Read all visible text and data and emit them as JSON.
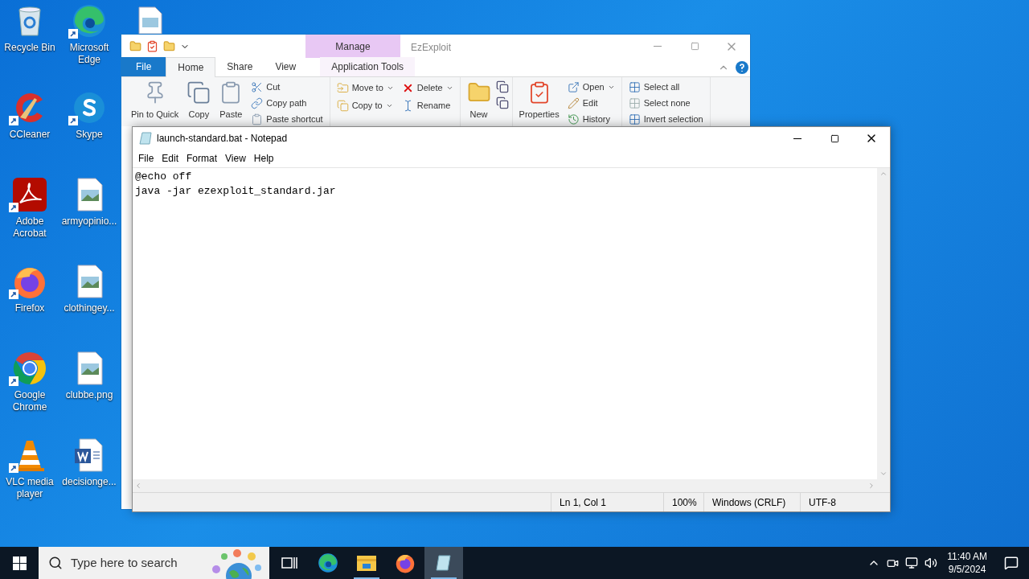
{
  "desktop_icons": [
    {
      "label": "Recycle Bin",
      "kind": "recycle",
      "shortcut": false
    },
    {
      "label": "Microsoft Edge",
      "kind": "edge",
      "shortcut": true
    },
    {
      "label": "CCleaner",
      "kind": "ccleaner",
      "shortcut": true
    },
    {
      "label": "Skype",
      "kind": "skype",
      "shortcut": true
    },
    {
      "label": "Adobe Acrobat",
      "kind": "acrobat",
      "shortcut": true
    },
    {
      "label": "armyopinio...",
      "kind": "image",
      "shortcut": false
    },
    {
      "label": "Firefox",
      "kind": "firefox",
      "shortcut": true
    },
    {
      "label": "clothingey...",
      "kind": "image",
      "shortcut": false
    },
    {
      "label": "Google Chrome",
      "kind": "chrome",
      "shortcut": true
    },
    {
      "label": "clubbe.png",
      "kind": "image",
      "shortcut": false
    },
    {
      "label": "VLC media player",
      "kind": "vlc",
      "shortcut": true
    },
    {
      "label": "decisionge...",
      "kind": "word",
      "shortcut": false
    }
  ],
  "explorer": {
    "context_tab": "Manage",
    "title": "EzExploit",
    "tabs": [
      {
        "label": "File",
        "kind": "file",
        "selected": false
      },
      {
        "label": "Home",
        "kind": "tab",
        "selected": true
      },
      {
        "label": "Share",
        "kind": "tab",
        "selected": false
      },
      {
        "label": "View",
        "kind": "tab",
        "selected": false
      },
      {
        "label": "Application Tools",
        "kind": "context",
        "selected": false
      }
    ],
    "groups": [
      {
        "items": [
          {
            "label": "Pin to Quick",
            "kind": "pin"
          },
          {
            "label": "Copy",
            "kind": "copy"
          },
          {
            "label": "Paste",
            "kind": "paste"
          },
          {
            "kind": "column",
            "items": [
              {
                "label": "Cut",
                "kind": "cut",
                "dropdown": false
              },
              {
                "label": "Copy path",
                "kind": "path",
                "dropdown": false
              },
              {
                "label": "Paste shortcut",
                "kind": "paste",
                "dropdown": false
              }
            ]
          }
        ]
      },
      {
        "items": [
          {
            "kind": "column",
            "items": [
              {
                "label": "Move to",
                "kind": "move",
                "dropdown": true
              },
              {
                "label": "Copy to",
                "kind": "copyto",
                "dropdown": true
              }
            ]
          },
          {
            "kind": "column",
            "items": [
              {
                "label": "Delete",
                "kind": "delete",
                "dropdown": true
              },
              {
                "label": "Rename",
                "kind": "rename",
                "dropdown": false
              }
            ]
          }
        ]
      },
      {
        "items": [
          {
            "label": "New",
            "kind": "folder"
          },
          {
            "kind": "iconcolumn"
          }
        ]
      },
      {
        "items": [
          {
            "label": "Properties",
            "kind": "properties"
          },
          {
            "kind": "column",
            "items": [
              {
                "label": "Open",
                "kind": "open",
                "dropdown": true
              },
              {
                "label": "Edit",
                "kind": "edit",
                "dropdown": false
              },
              {
                "label": "History",
                "kind": "history",
                "dropdown": false
              }
            ]
          }
        ]
      },
      {
        "items": [
          {
            "kind": "column",
            "items": [
              {
                "label": "Select all",
                "kind": "selall",
                "dropdown": false
              },
              {
                "label": "Select none",
                "kind": "selnone",
                "dropdown": false
              },
              {
                "label": "Invert selection",
                "kind": "selall",
                "dropdown": false
              }
            ]
          }
        ]
      }
    ]
  },
  "notepad": {
    "title": "launch-standard.bat - Notepad",
    "menu": [
      "File",
      "Edit",
      "Format",
      "View",
      "Help"
    ],
    "lines": [
      "@echo off",
      "java -jar ezexploit_standard.jar"
    ],
    "status": [
      "Ln 1, Col 1",
      "100%",
      "Windows (CRLF)",
      "UTF-8"
    ]
  },
  "taskbar": {
    "search_placeholder": "Type here to search",
    "apps": [
      {
        "kind": "taskview",
        "running": false,
        "active": false
      },
      {
        "kind": "edge",
        "running": false,
        "active": false
      },
      {
        "kind": "explorer",
        "running": true,
        "active": false
      },
      {
        "kind": "firefox",
        "running": false,
        "active": false
      },
      {
        "kind": "notepad",
        "running": true,
        "active": true
      }
    ],
    "time": "11:40 AM",
    "date": "9/5/2024"
  }
}
